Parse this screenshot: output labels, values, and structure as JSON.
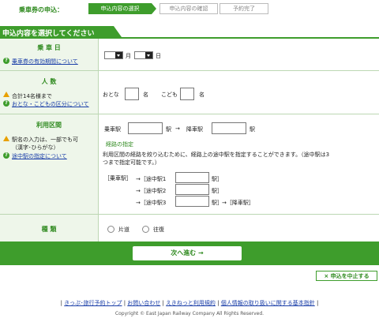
{
  "header": {
    "title": "乗車券の申込：",
    "steps": [
      {
        "label": "申込内容の選択",
        "active": true
      },
      {
        "label": "申込内容の確認",
        "active": false
      },
      {
        "label": "予約完了",
        "active": false
      }
    ]
  },
  "section_title": "申込内容を選択してください",
  "date_row": {
    "heading": "乗 車 日",
    "help_link": "乗車券の有効期間について",
    "month_unit": "月",
    "day_unit": "日"
  },
  "people_row": {
    "heading": "人 数",
    "note": "合計14名様まで",
    "help_link": "おとな・こどもの区分について",
    "adult_label": "おとな",
    "adult_unit": "名",
    "child_label": "こども",
    "child_unit": "名"
  },
  "route_row": {
    "heading": "利用区間",
    "note1": "駅名の入力は、一部でも可",
    "note2": "（漢字･ひらがな）",
    "help_link": "途中駅の指定について",
    "from_label": "乗車駅",
    "station_unit": "駅",
    "arrow": "→",
    "to_label": "降車駅",
    "via_heading": "経路の指定",
    "via_desc1": "利用区間の経路を絞り込むために、経路上の途中駅を指定することができます。（途中駅は3",
    "via_desc2": "つまで指定可能です。）",
    "bracket_from": "［乗車駅］",
    "via_stations": [
      {
        "label": "→［途中駅1",
        "close": "駅］"
      },
      {
        "label": "→［途中駅2",
        "close": "駅］"
      },
      {
        "label": "→［途中駅3",
        "close": "駅］"
      }
    ],
    "to_suffix": "→［降車駅］"
  },
  "type_row": {
    "heading": "種 類",
    "one_way": "片道",
    "round_trip": "往復"
  },
  "next_button": "次へ進む →",
  "cancel_button": "× 申込を中止する",
  "footer": {
    "links": [
      "きっぷ･旅行予約トップ",
      "お問い合わせ",
      "えきねっと利用規約",
      "個人情報の取り扱いに関する基本指針"
    ],
    "copyright": "Copyright © East Japan Railway Company All Rights Reserved."
  },
  "colors": {
    "brand_green": "#3e9d2c",
    "link_blue": "#1a3ea8",
    "warn": "#e8a000"
  }
}
